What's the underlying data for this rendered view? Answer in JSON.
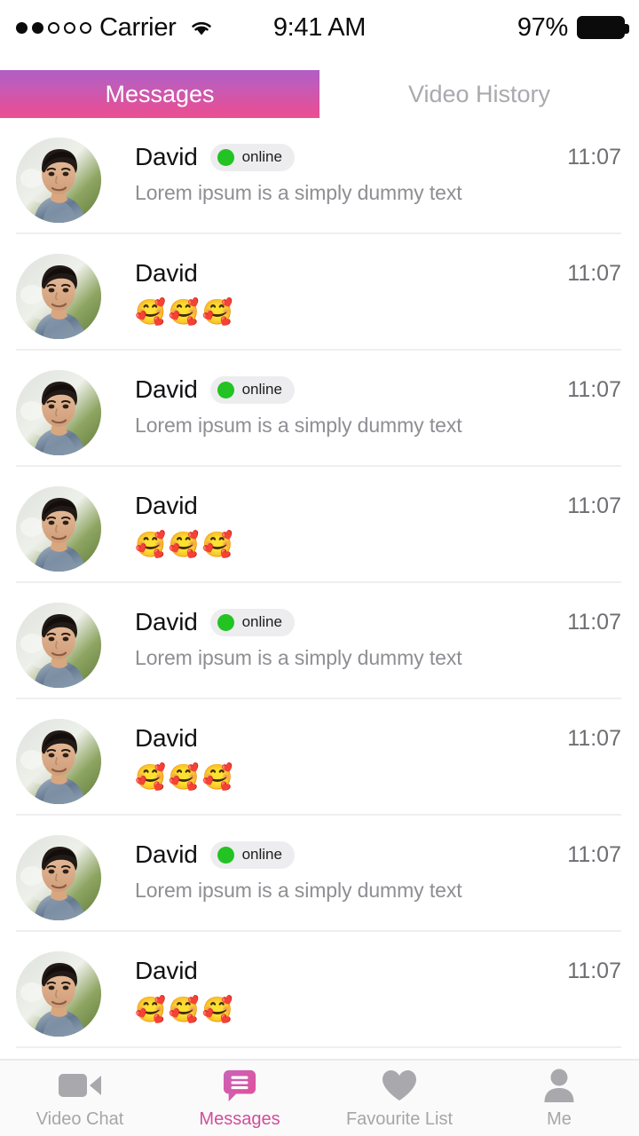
{
  "status_bar": {
    "carrier": "Carrier",
    "signal_dots_filled": 2,
    "signal_dots_total": 5,
    "wifi_icon": "wifi-icon",
    "time": "9:41 AM",
    "battery_percent": "97%",
    "battery_icon": "battery-full-icon"
  },
  "top_tabs": {
    "active_index": 0,
    "items": [
      {
        "label": "Messages"
      },
      {
        "label": "Video History"
      }
    ],
    "active_gradient_start": "#b05ec4",
    "active_gradient_end": "#ec4f92"
  },
  "messages": {
    "online_label": "online",
    "online_dot_color": "#22c322",
    "rows": [
      {
        "name": "David",
        "online": true,
        "preview": "Lorem ipsum is a simply dummy text",
        "emoji": "",
        "time": "11:07"
      },
      {
        "name": "David",
        "online": false,
        "preview": "",
        "emoji": "🥰🥰🥰",
        "time": "11:07"
      },
      {
        "name": "David",
        "online": true,
        "preview": "Lorem ipsum is a simply dummy text",
        "emoji": "",
        "time": "11:07"
      },
      {
        "name": "David",
        "online": false,
        "preview": "",
        "emoji": "🥰🥰🥰",
        "time": "11:07"
      },
      {
        "name": "David",
        "online": true,
        "preview": "Lorem ipsum is a simply dummy text",
        "emoji": "",
        "time": "11:07"
      },
      {
        "name": "David",
        "online": false,
        "preview": "",
        "emoji": "🥰🥰🥰",
        "time": "11:07"
      },
      {
        "name": "David",
        "online": true,
        "preview": "Lorem ipsum is a simply dummy text",
        "emoji": "",
        "time": "11:07"
      },
      {
        "name": "David",
        "online": false,
        "preview": "",
        "emoji": "🥰🥰🥰",
        "time": "11:07"
      }
    ]
  },
  "bottom_nav": {
    "active_index": 1,
    "active_color": "#cf4e9b",
    "inactive_color": "#a6a6aa",
    "items": [
      {
        "label": "Video Chat",
        "icon": "video-camera-icon"
      },
      {
        "label": "Messages",
        "icon": "chat-bubble-icon"
      },
      {
        "label": "Favourite List",
        "icon": "heart-icon"
      },
      {
        "label": "Me",
        "icon": "person-icon"
      }
    ]
  }
}
